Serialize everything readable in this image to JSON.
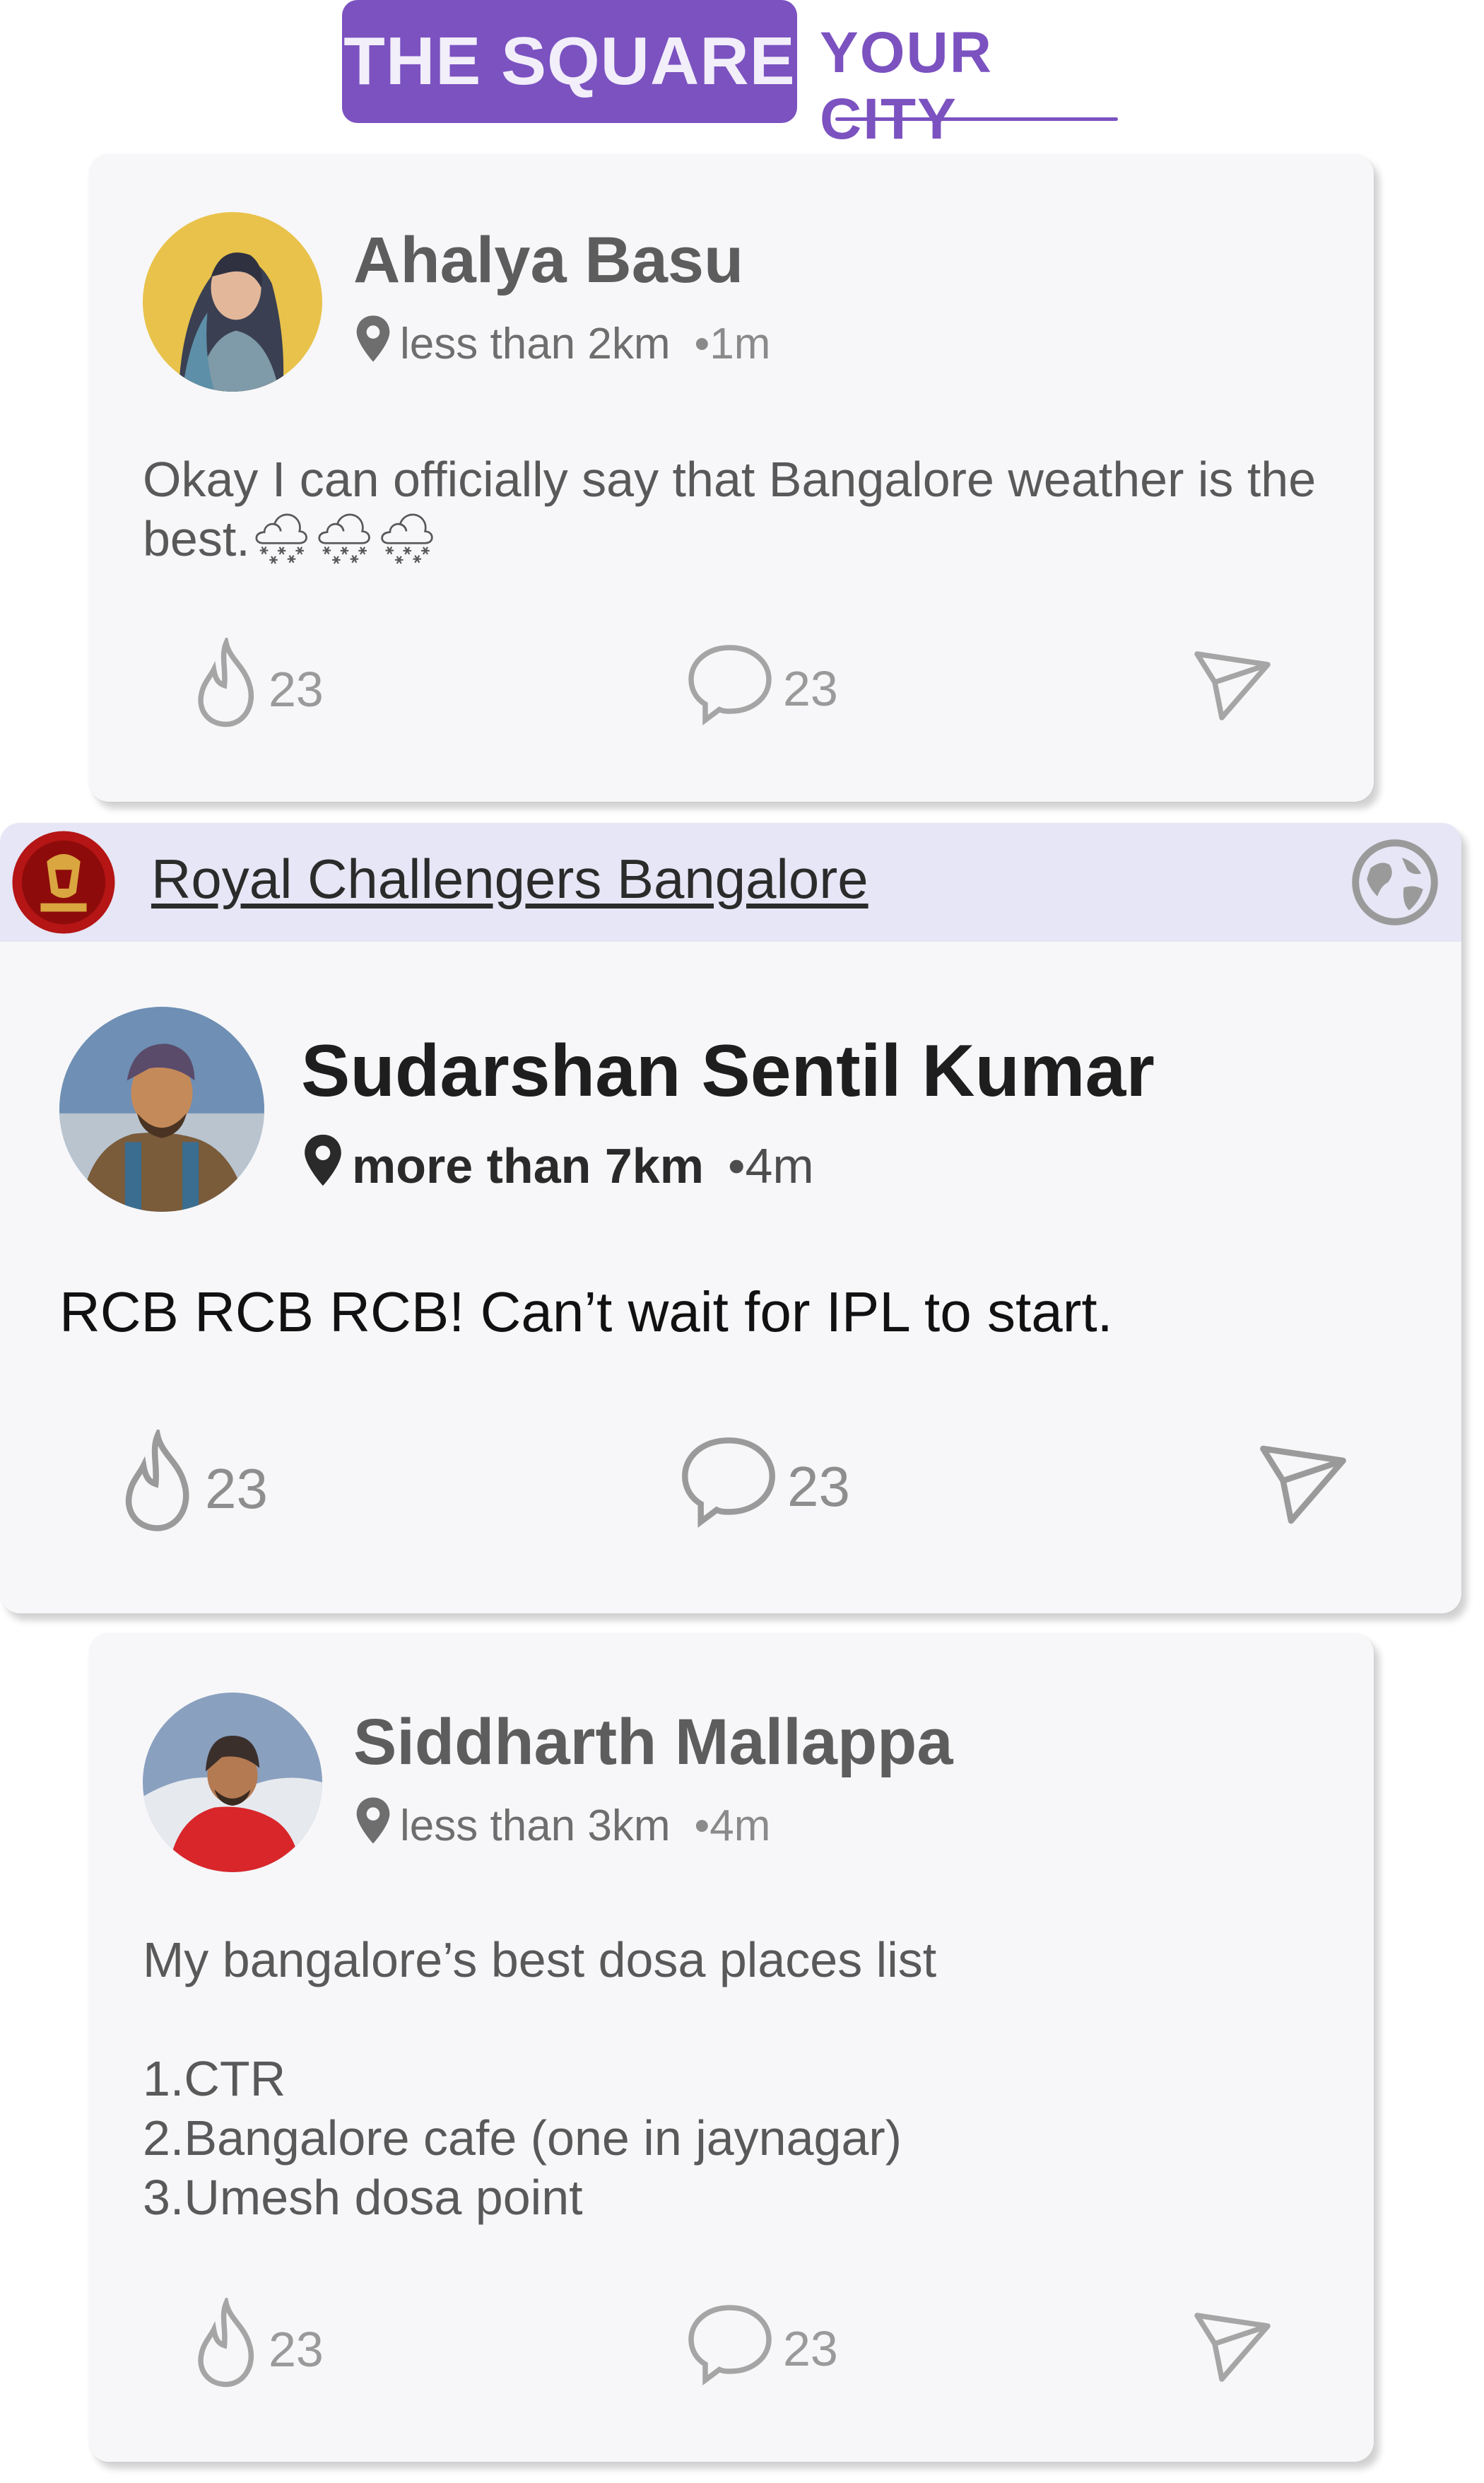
{
  "tabs": {
    "active": "THE SQUARE",
    "inactive": "YOUR  CITY"
  },
  "colors": {
    "accent": "#7b52c0",
    "card_background": "#f7f7f9",
    "community_header_background": "#e6e6f6"
  },
  "posts": [
    {
      "author": "Ahalya Basu",
      "distance": "less than 2km",
      "time": "•1m",
      "text": "Okay I can officially say that Bangalore weather is the best.🌨🌨🌨",
      "likes": "23",
      "comments": "23",
      "icons": [
        "location-pin-icon",
        "flame-icon",
        "comment-icon",
        "send-icon"
      ]
    },
    {
      "community": "Royal Challengers Bangalore",
      "community_icons": [
        "rcb-logo",
        "globe-icon"
      ],
      "author": "Sudarshan Sentil Kumar",
      "distance": "more than 7km",
      "time": "•4m",
      "text": "RCB RCB RCB! Can’t wait for IPL to start.",
      "likes": "23",
      "comments": "23",
      "icons": [
        "location-pin-icon",
        "flame-icon",
        "comment-icon",
        "send-icon"
      ]
    },
    {
      "author": "Siddharth Mallappa",
      "distance": "less than 3km",
      "time": "•4m",
      "text": "My bangalore’s best dosa places list\n\n1.CTR\n2.Bangalore cafe (one in jaynagar)\n3.Umesh dosa point",
      "likes": "23",
      "comments": "23",
      "icons": [
        "location-pin-icon",
        "flame-icon",
        "comment-icon",
        "send-icon"
      ]
    }
  ]
}
